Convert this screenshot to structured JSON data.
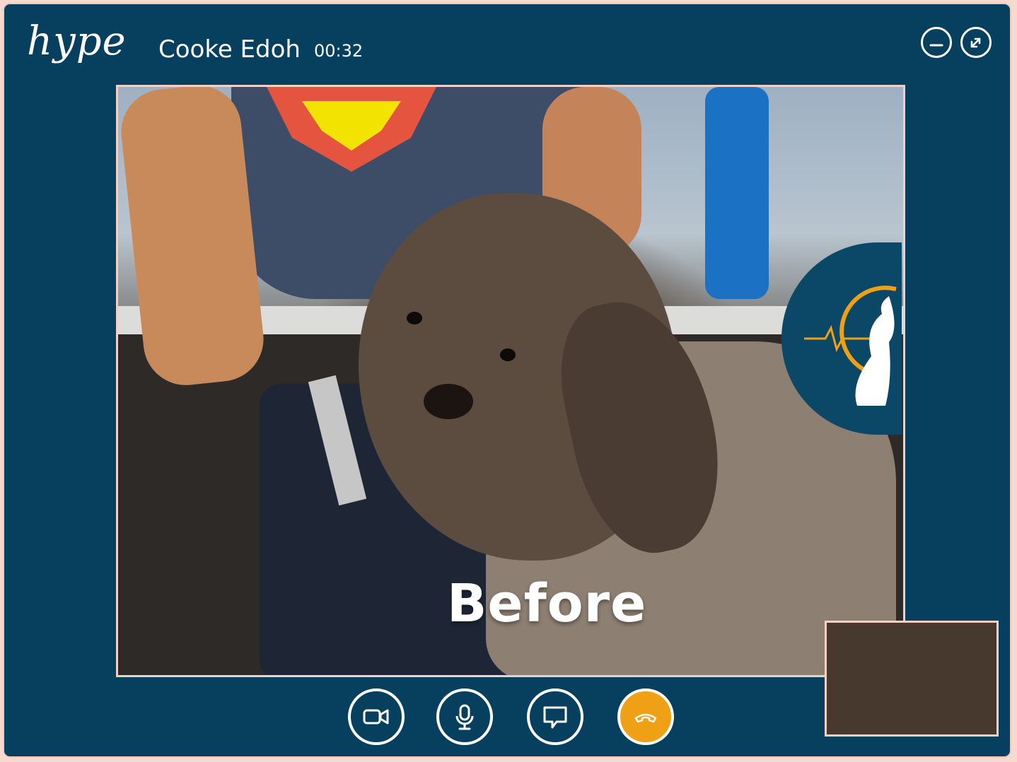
{
  "app": {
    "logo": "hype"
  },
  "call": {
    "caller_name": "Cooke Edoh",
    "duration": "00:32"
  },
  "window_controls": {
    "minimize_icon": "minimize-icon",
    "popout_icon": "popout-icon"
  },
  "main_video": {
    "overlay_text": "Before",
    "badge_icon": "pet-clinic-logo-icon"
  },
  "controls": [
    {
      "name": "video",
      "icon": "video-camera-icon"
    },
    {
      "name": "microphone",
      "icon": "microphone-icon"
    },
    {
      "name": "chat",
      "icon": "chat-bubble-icon"
    },
    {
      "name": "end-call",
      "icon": "hang-up-icon",
      "color": "#f0a014"
    }
  ],
  "colors": {
    "background": "#06405e",
    "border": "#f3cfc4",
    "accent": "#f0a014"
  }
}
